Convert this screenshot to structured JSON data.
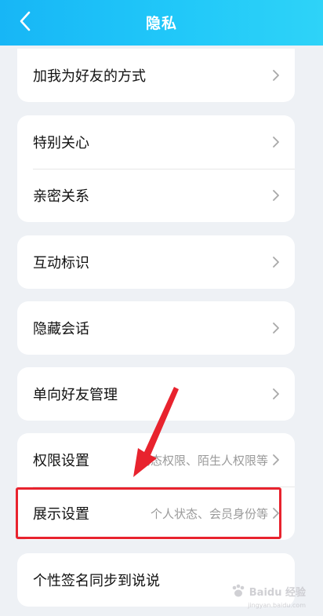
{
  "header": {
    "title": "隐私"
  },
  "rows": {
    "add_friend_method": "加我为好友的方式",
    "special_care": "特别关心",
    "close_relation": "亲密关系",
    "interaction_marks": "互动标识",
    "hide_chats": "隐藏会话",
    "one_way_friends": "单向好友管理",
    "permission_settings": "权限设置",
    "permission_settings_sub": "动态权限、陌生人权限等",
    "display_settings": "展示设置",
    "display_settings_sub": "个人状态、会员身份等",
    "signature_sync": "个性签名同步到说说"
  },
  "watermark": {
    "text": "Baidu 经验",
    "sub": "jingyan.baidu.com"
  },
  "colors": {
    "header_start": "#17b6f6",
    "header_end": "#2ed3f8",
    "highlight": "#e8232e",
    "background": "#eef1f5"
  }
}
